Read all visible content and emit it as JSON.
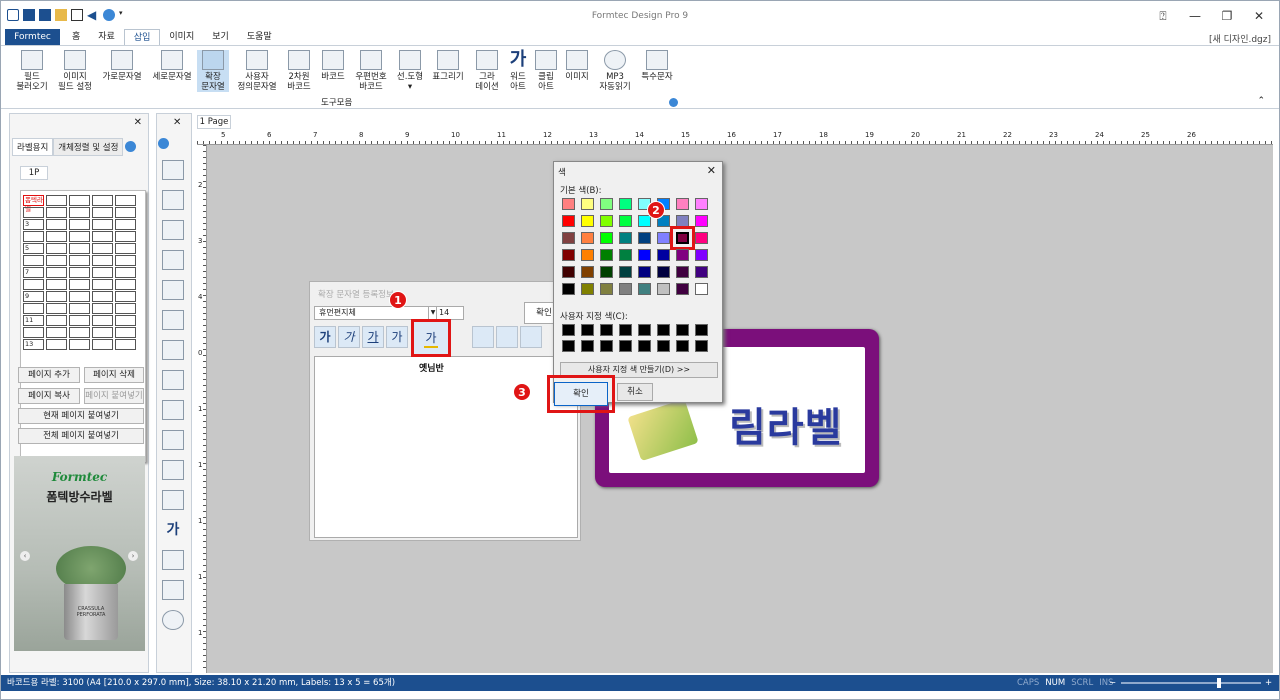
{
  "app": {
    "title": "Formtec Design Pro 9",
    "doc_name": "[새 디자인.dgz]"
  },
  "menu": {
    "app_tab": "Formtec",
    "tabs": [
      "홈",
      "자료",
      "삽입",
      "이미지",
      "보기",
      "도움말"
    ],
    "active": "삽입"
  },
  "ribbon": {
    "buttons": [
      {
        "label": "필드\n불러오기",
        "icon": "field-load-icon"
      },
      {
        "label": "이미지\n필드 설정",
        "icon": "image-field-icon"
      },
      {
        "label": "가로문자열",
        "icon": "horizontal-text-icon"
      },
      {
        "label": "세로문자열",
        "icon": "vertical-text-icon"
      },
      {
        "label": "확장\n문자열",
        "icon": "extended-text-icon"
      },
      {
        "label": "사용자\n정의문자열",
        "icon": "custom-text-icon"
      },
      {
        "label": "2차원\n바코드",
        "icon": "qr-code-icon"
      },
      {
        "label": "바코드",
        "icon": "barcode-icon"
      },
      {
        "label": "우편번호\n바코드",
        "icon": "postal-barcode-icon"
      },
      {
        "label": "선.도형\n▾",
        "icon": "shape-icon"
      },
      {
        "label": "표그리기",
        "icon": "table-icon"
      },
      {
        "label": "그라\n데이션",
        "icon": "gradation-icon"
      },
      {
        "label": "워드\n아트",
        "icon": "word-art-icon"
      },
      {
        "label": "클립\n아트",
        "icon": "clip-art-icon"
      },
      {
        "label": "이미지",
        "icon": "image-icon"
      },
      {
        "label": "MP3\n자동읽기",
        "icon": "mp3-icon"
      },
      {
        "label": "특수문자",
        "icon": "special-char-icon"
      }
    ],
    "group_label": "도구모음"
  },
  "left_panel": {
    "tabs": [
      "라벨용지",
      "개체정렬 및 설정"
    ],
    "page_tab": "1P",
    "thumb_cells": [
      "폼텍라벨",
      "",
      "",
      "",
      "",
      "",
      "",
      "",
      "",
      "",
      "3",
      "",
      "",
      "",
      "",
      "",
      "",
      "",
      "",
      "",
      "5",
      "",
      "",
      "",
      "",
      "",
      "",
      "",
      "",
      "",
      "7",
      "",
      "",
      "",
      "",
      "",
      "",
      "",
      "",
      "",
      "9",
      "",
      "",
      "",
      "",
      "",
      "",
      "",
      "",
      "",
      "11",
      "",
      "",
      "",
      "",
      "",
      "",
      "",
      "",
      "",
      "13",
      "",
      "",
      "",
      ""
    ],
    "buttons": {
      "add_page": "페이지 추가",
      "delete_page": "페이지 삭제",
      "copy_page": "페이지 복사",
      "paste_page": "페이지 붙여넣기",
      "paste_current": "현재 페이지 붙여넣기",
      "paste_all": "전체 페이지 붙여넣기"
    },
    "ad": {
      "brand": "Formtec",
      "subtitle": "폼텍방수라벨",
      "pot_text": "CRASSULA\nPERFORATA"
    }
  },
  "document": {
    "page_tab": "1 Page",
    "ruler_top": [
      "5",
      "6",
      "7",
      "8",
      "9",
      "10",
      "11",
      "12",
      "13",
      "14",
      "15",
      "16",
      "17",
      "18",
      "19",
      "20",
      "21",
      "22",
      "23",
      "24",
      "25",
      "26"
    ],
    "ruler_left": [
      "2",
      "3",
      "4",
      "0",
      "1",
      "1",
      "1",
      "1",
      "1"
    ],
    "label_text": "림라벨"
  },
  "extended_string_dialog": {
    "title": "확장 문자열 등록정보",
    "font": "휴먼편지체",
    "size": "14",
    "ok": "확인",
    "format_buttons": [
      "가",
      "가",
      "가",
      "가"
    ],
    "color_button": "가",
    "tooltip": "옛님반"
  },
  "color_dialog": {
    "title": "색",
    "basic_label": "기본 색(B):",
    "custom_label": "사용자 지정 색(C):",
    "define_custom": "사용자 지정 색 만들기(D) >>",
    "ok": "확인",
    "cancel": "취소",
    "basic_colors": [
      "#ff8080",
      "#ffff80",
      "#80ff80",
      "#00ff80",
      "#80ffff",
      "#0080ff",
      "#ff80c0",
      "#ff80ff",
      "#ff0000",
      "#ffff00",
      "#80ff00",
      "#00ff40",
      "#00ffff",
      "#0080c0",
      "#8080c0",
      "#ff00ff",
      "#804040",
      "#ff8040",
      "#00ff00",
      "#008080",
      "#004080",
      "#8080ff",
      "#800040",
      "#ff0080",
      "#800000",
      "#ff8000",
      "#008000",
      "#008040",
      "#0000ff",
      "#0000a0",
      "#800080",
      "#8000ff",
      "#400000",
      "#804000",
      "#004000",
      "#004040",
      "#000080",
      "#000040",
      "#400040",
      "#400080",
      "#000000",
      "#808000",
      "#808040",
      "#808080",
      "#408080",
      "#c0c0c0",
      "#400040",
      "#ffffff"
    ],
    "selected_index": 22
  },
  "badges": [
    "1",
    "2",
    "3"
  ],
  "status": {
    "text": "바코드용 라벨: 3100 (A4 [210.0 x 297.0 mm], Size: 38.10 x 21.20 mm,  Labels: 13 x 5 = 65개)",
    "indicators": [
      {
        "label": "CAPS",
        "on": false
      },
      {
        "label": "NUM",
        "on": true
      },
      {
        "label": "SCRL",
        "on": false
      },
      {
        "label": "INS",
        "on": false
      }
    ],
    "zoom_minus": "−",
    "zoom_plus": "+"
  },
  "colors": {
    "accent": "#1c4f8f",
    "highlight": "#e01515",
    "label_border": "#7b0f7b",
    "label_text": "#2a3a9e"
  }
}
